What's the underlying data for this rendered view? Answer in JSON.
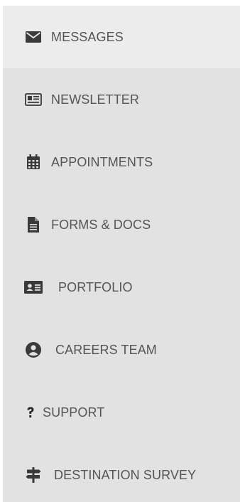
{
  "sidebar": {
    "items": [
      {
        "label": "MESSAGES",
        "icon": "envelope-icon",
        "active": true
      },
      {
        "label": "NEWSLETTER",
        "icon": "newspaper-icon",
        "active": false
      },
      {
        "label": "APPOINTMENTS",
        "icon": "calendar-icon",
        "active": false
      },
      {
        "label": "FORMS & DOCS",
        "icon": "document-icon",
        "active": false
      },
      {
        "label": "PORTFOLIO",
        "icon": "id-card-icon",
        "active": false
      },
      {
        "label": "CAREERS TEAM",
        "icon": "user-circle-icon",
        "active": false
      },
      {
        "label": "SUPPORT",
        "icon": "question-icon",
        "active": false
      },
      {
        "label": "DESTINATION SURVEY",
        "icon": "signpost-icon",
        "active": false
      }
    ]
  },
  "colors": {
    "sidebar_bg": "#e2e2e2",
    "active_bg": "#ececec",
    "text": "#555555",
    "icon": "#3a3a3a"
  }
}
